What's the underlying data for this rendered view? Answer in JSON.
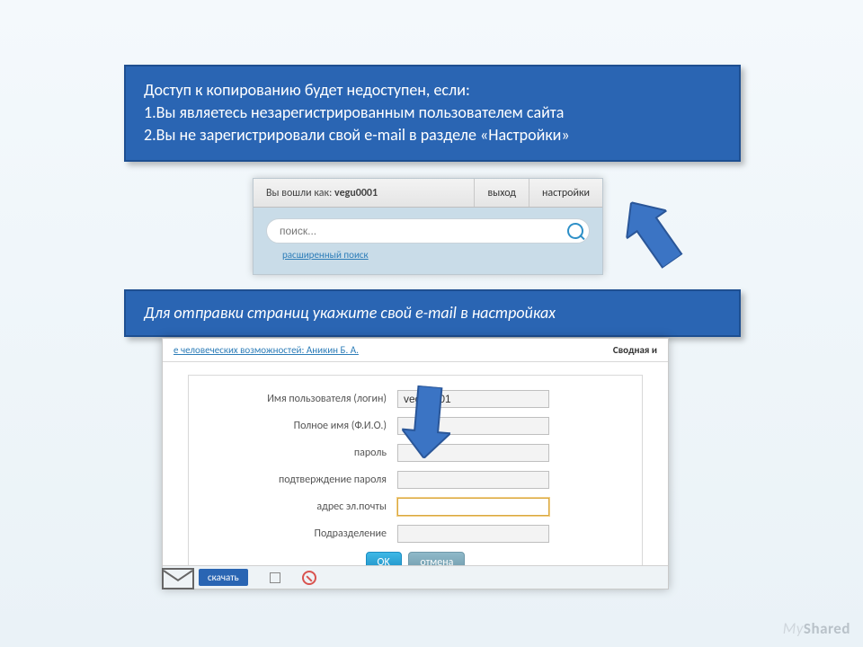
{
  "callout1": {
    "title": "Доступ к копированию будет недоступен, если:",
    "line1": "1.Вы являетесь незарегистрированным пользователем сайта",
    "line2": "2.Вы не зарегистрировали свой e-mail в разделе «Настройки»"
  },
  "callout2": {
    "text": "Для отправки страниц укажите свой e-mail в настройках"
  },
  "topbar": {
    "logged_prefix": "Вы вошли как: ",
    "username": "vegu0001",
    "logout": "выход",
    "settings": "настройки",
    "search_placeholder": "поиск...",
    "advanced": "расширенный поиск"
  },
  "form": {
    "crumb_left": "е человеческих возможностей: Аникин Б. А.",
    "crumb_right": "Сводная и",
    "fields": {
      "login_label": "Имя пользователя (логин)",
      "login_value": "vegu0001",
      "fullname_label": "Полное имя (Ф.И.О.)",
      "password_label": "пароль",
      "confirm_label": "подтверждение пароля",
      "email_label": "адрес эл.почты",
      "dept_label": "Подразделение"
    },
    "ok": "OK",
    "cancel": "отмена",
    "download": "скачать"
  },
  "watermark": "MyShared"
}
